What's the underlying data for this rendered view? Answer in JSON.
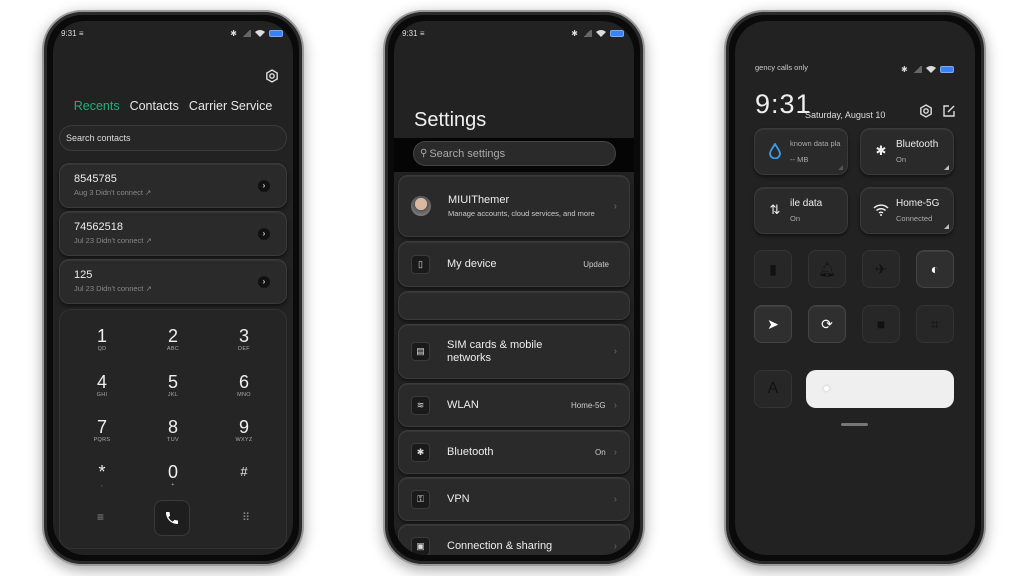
{
  "status_bar": {
    "time": "9:31",
    "notification_glyph": "≡"
  },
  "dialer": {
    "tabs": [
      {
        "label": "Recents",
        "active": true
      },
      {
        "label": "Contacts",
        "active": false
      },
      {
        "label": "Carrier Service",
        "active": false
      }
    ],
    "search_placeholder": "Search contacts",
    "recents": [
      {
        "number": "8545785",
        "detail": "Aug 3 Didn't connect ↗"
      },
      {
        "number": "74562518",
        "detail": "Jul 23 Didn't connect ↗"
      },
      {
        "number": "125",
        "detail": "Jul 23 Didn't connect ↗"
      }
    ],
    "keys": [
      {
        "digit": "1",
        "letters": "QD"
      },
      {
        "digit": "2",
        "letters": "ABC"
      },
      {
        "digit": "3",
        "letters": "DEF"
      },
      {
        "digit": "4",
        "letters": "GHI"
      },
      {
        "digit": "5",
        "letters": "JKL"
      },
      {
        "digit": "6",
        "letters": "MNO"
      },
      {
        "digit": "7",
        "letters": "PQRS"
      },
      {
        "digit": "8",
        "letters": "TUV"
      },
      {
        "digit": "9",
        "letters": "WXYZ"
      },
      {
        "digit": "*",
        "letters": ","
      },
      {
        "digit": "0",
        "letters": "+"
      },
      {
        "digit": "#",
        "letters": ""
      }
    ],
    "accent_color": "#1fb07a"
  },
  "settings": {
    "title": "Settings",
    "search_placeholder": "Search settings",
    "account": {
      "name": "MIUIThemer",
      "subtitle": "Manage accounts, cloud services, and more"
    },
    "items": [
      {
        "label": "My device",
        "value": "Update",
        "icon": "phone-icon"
      },
      {
        "label": "SIM cards & mobile networks",
        "value": "",
        "icon": "sim-card-icon"
      },
      {
        "label": "WLAN",
        "value": "Home-5G",
        "icon": "wifi-icon"
      },
      {
        "label": "Bluetooth",
        "value": "On",
        "icon": "bluetooth-icon"
      },
      {
        "label": "VPN",
        "value": "",
        "icon": "key-icon"
      },
      {
        "label": "Connection & sharing",
        "value": "",
        "icon": "connection-icon"
      }
    ]
  },
  "control_center": {
    "carrier_text": "gency calls only",
    "time": "9:31",
    "date": "Saturday, August 10",
    "tiles": [
      {
        "title": "known data pla",
        "subtitle": "-- MB",
        "icon": "water-drop-icon"
      },
      {
        "title": "Bluetooth",
        "subtitle": "On",
        "icon": "bluetooth-icon"
      },
      {
        "title": "ile data",
        "subtitle": "On",
        "icon": "mobile-data-icon"
      },
      {
        "title": "Home-5G",
        "subtitle": "Connected",
        "icon": "wifi-icon"
      }
    ],
    "toggles": [
      {
        "name": "flashlight",
        "on": false
      },
      {
        "name": "ringer",
        "on": false
      },
      {
        "name": "airplane-mode",
        "on": false
      },
      {
        "name": "dark-mode",
        "on": true
      },
      {
        "name": "location",
        "on": true
      },
      {
        "name": "rotation-lock",
        "on": true
      },
      {
        "name": "screen-record",
        "on": false
      },
      {
        "name": "scanner",
        "on": false
      }
    ],
    "auto_brightness_label": "A",
    "brightness_level": 0.05,
    "drop_color": "#3b9de8"
  }
}
